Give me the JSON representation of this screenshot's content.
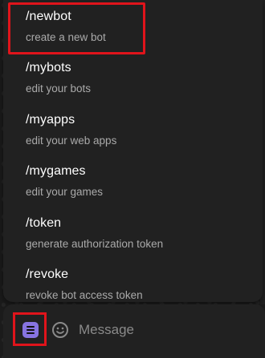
{
  "commands": [
    {
      "name": "/newbot",
      "description": "create a new bot"
    },
    {
      "name": "/mybots",
      "description": "edit your bots"
    },
    {
      "name": "/myapps",
      "description": "edit your web apps"
    },
    {
      "name": "/mygames",
      "description": "edit your games"
    },
    {
      "name": "/token",
      "description": "generate authorization token"
    },
    {
      "name": "/revoke",
      "description": "revoke bot access token"
    }
  ],
  "composer": {
    "placeholder": "Message"
  },
  "icons": {
    "menu": "bot-menu-icon",
    "emoji": "smiley-icon"
  },
  "colors": {
    "panel": "#212121",
    "accent": "#8774e1",
    "highlight": "#e0141b",
    "secondary_text": "#aaaaaa"
  }
}
